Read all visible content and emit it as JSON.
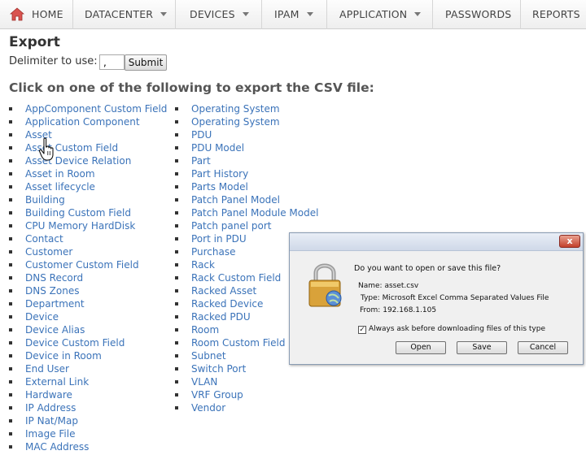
{
  "nav": {
    "home": "HOME",
    "datacenter": "DATACENTER",
    "devices": "DEVICES",
    "ipam": "IPAM",
    "application": "APPLICATION",
    "passwords": "PASSWORDS",
    "reports": "REPORTS"
  },
  "page": {
    "title": "Export",
    "delimiter_label": "Delimiter to use:",
    "delimiter_value": ",",
    "submit_label": "Submit",
    "subheading": "Click on one of the following to export the CSV file:"
  },
  "export_links_col1": [
    "AppComponent Custom Field",
    "Application Component",
    "Asset",
    "Asset Custom Field",
    "Asset Device Relation",
    "Asset in Room",
    "Asset lifecycle",
    "Building",
    "Building Custom Field",
    "CPU Memory HardDisk",
    "Contact",
    "Customer",
    "Customer Custom Field",
    "DNS Record",
    "DNS Zones",
    "Department",
    "Device",
    "Device Alias",
    "Device Custom Field",
    "Device in Room",
    "End User",
    "External Link",
    "Hardware",
    "IP Address",
    "IP Nat/Map",
    "Image File",
    "MAC Address"
  ],
  "export_links_col2": [
    "Operating System",
    "Operating System",
    "PDU",
    "PDU Model",
    "Part",
    "Part History",
    "Parts Model",
    "Patch Panel Model",
    "Patch Panel Module Model",
    "Patch panel port",
    "Port in PDU",
    "Purchase",
    "Rack",
    "Rack Custom Field",
    "Racked Asset",
    "Racked Device",
    "Racked PDU",
    "Room",
    "Room Custom Field",
    "Subnet",
    "Switch Port",
    "VLAN",
    "VRF Group",
    "Vendor"
  ],
  "dialog": {
    "question": "Do you want to open or save this file?",
    "name_label": "Name:",
    "name_value": "asset.csv",
    "type_label": "Type:",
    "type_value": "Microsoft Excel Comma Separated Values File",
    "from_label": "From:",
    "from_value": "192.168.1.105",
    "always_ask_label": "Always ask before downloading files of this type",
    "always_ask_checked": true,
    "open_label": "Open",
    "save_label": "Save",
    "cancel_label": "Cancel",
    "close_glyph": "x"
  },
  "colors": {
    "link": "#3b73b9",
    "home_icon": "#d9534f",
    "close_button": "#c33f2b"
  },
  "icons": [
    "home-icon",
    "chevron-down-icon",
    "hand-cursor-icon",
    "lock-icon",
    "close-icon"
  ]
}
